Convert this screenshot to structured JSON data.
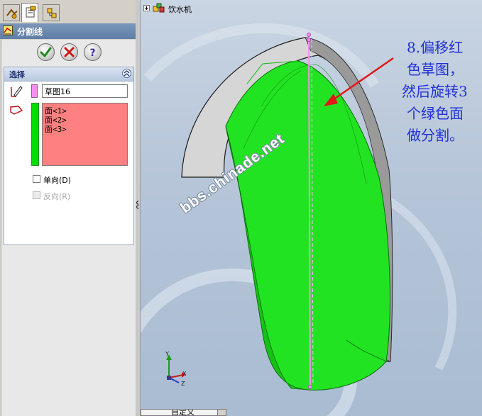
{
  "property_manager": {
    "tabs": [
      {
        "name": "feature-manager",
        "icon": "feature-tree-icon"
      },
      {
        "name": "property-manager",
        "icon": "property-sheet-icon"
      },
      {
        "name": "configuration-manager",
        "icon": "configuration-icon"
      }
    ],
    "title": "分割线",
    "title_icon": "split-line-icon",
    "buttons": [
      {
        "name": "ok",
        "icon": "checkmark-icon"
      },
      {
        "name": "cancel",
        "icon": "x-icon"
      },
      {
        "name": "help",
        "icon": "question-icon",
        "label": "?"
      }
    ],
    "selection_group": {
      "title": "选择",
      "sketch_field_value": "草图16",
      "faces": [
        "面<1>",
        "面<2>",
        "面<3>"
      ],
      "single_direction_label": "单向(D)",
      "reverse_direction_label": "反向(R)"
    }
  },
  "graphics": {
    "tree_root_label": "饮水机",
    "annotation_lines": [
      "8.偏移红",
      "色草图，",
      "然后旋转3",
      "个绿色面",
      "做分割。"
    ],
    "watermark": "bbs.chinade.net",
    "triad_labels": {
      "x": "X",
      "y": "Y",
      "z": "Z"
    },
    "view_combo_value": "自定义"
  },
  "colors": {
    "header_blue": "#6682ac",
    "sketch_pink": "#f58ef0",
    "face_green": "#00dd00",
    "face_list_red": "#ff8080",
    "annotation_blue": "#2231d6",
    "arrow_red": "#e01818"
  }
}
